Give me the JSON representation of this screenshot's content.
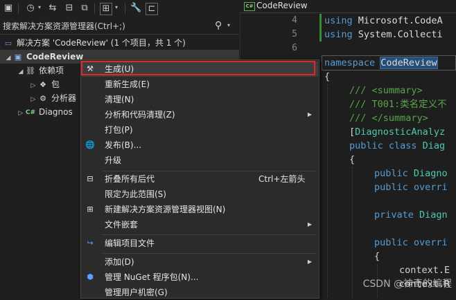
{
  "solution_explorer": {
    "search": {
      "placeholder": "搜索解决方案资源管理器(Ctrl+;)"
    },
    "tree": {
      "solution_label": "解决方案 'CodeReview' (1 个项目，共 1 个)",
      "project_label": "CodeReview",
      "dependencies_label": "依赖项",
      "packages_label": "包",
      "analyzers_label": "分析器",
      "file_label": "Diagnos"
    }
  },
  "editor": {
    "tab_label": "CodeReview",
    "cs_badge": "C#",
    "line_numbers": [
      "4",
      "5",
      "6"
    ],
    "lines": {
      "l4_kw": "using",
      "l4_rest": " Microsoft.CodeA",
      "l5_kw": "using",
      "l5_rest": " System.Collecti",
      "l7_kw": "namespace",
      "l7_name": "CodeReview",
      "l8": "{",
      "l9": "/// <summary>",
      "l10": "/// T001:类名定义不",
      "l11": "/// </summary>",
      "l12_open": "[",
      "l12_attr": "DiagnosticAnalyz",
      "l13_kw": "public class",
      "l13_name": " Diag",
      "l14": "{",
      "l15_kw": "public",
      "l15_name": " Diagno",
      "l16_kw": "public overri",
      "l18_kw": "private",
      "l18_name": " Diagn",
      "l20_kw": "public overri",
      "l21": "{",
      "l22": "context.E",
      "l23": "context.R"
    }
  },
  "context_menu": {
    "items": {
      "build": "生成(U)",
      "rebuild": "重新生成(E)",
      "clean": "清理(N)",
      "analyze": "分析和代码清理(Z)",
      "pack": "打包(P)",
      "publish": "发布(B)...",
      "upgrade": "升级",
      "collapse": "折叠所有后代",
      "collapse_shortcut": "Ctrl+左箭头",
      "scope": "限定为此范围(S)",
      "new_view": "新建解决方案资源管理器视图(N)",
      "file_nesting": "文件嵌套",
      "edit_project": "编辑项目文件",
      "add": "添加(D)",
      "nuget": "管理 NuGet 程序包(N)...",
      "user_secrets": "管理用户机密(G)"
    }
  },
  "watermark": "CSDN @神奇的编程",
  "colors": {
    "highlight_border": "#e02828",
    "keyword": "#569cd6",
    "type": "#4ec9b0",
    "comment": "#57a64a"
  }
}
